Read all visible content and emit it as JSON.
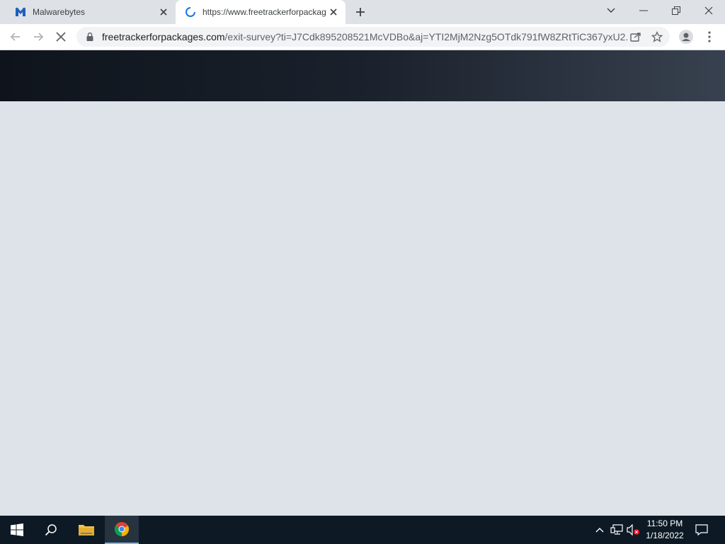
{
  "browser": {
    "tabs": [
      {
        "title": "Malwarebytes",
        "favicon": "malwarebytes-logo-icon",
        "active": false
      },
      {
        "title": "https://www.freetrackerforpackag",
        "favicon": "loading-spinner-icon",
        "active": true
      }
    ],
    "address": {
      "host": "freetrackerforpackages.com",
      "path": "/exit-survey?ti=J7Cdk895208521McVDBo&aj=YTI2MjM2Nzg5OTdk791fW8ZRtTiC367yxU2..."
    }
  },
  "taskbar": {
    "time": "11:50 PM",
    "date": "1/18/2022"
  },
  "colors": {
    "accent_blue": "#1b5fbd",
    "page_bg": "#dee3ea",
    "header_dark": "#0f141c"
  }
}
